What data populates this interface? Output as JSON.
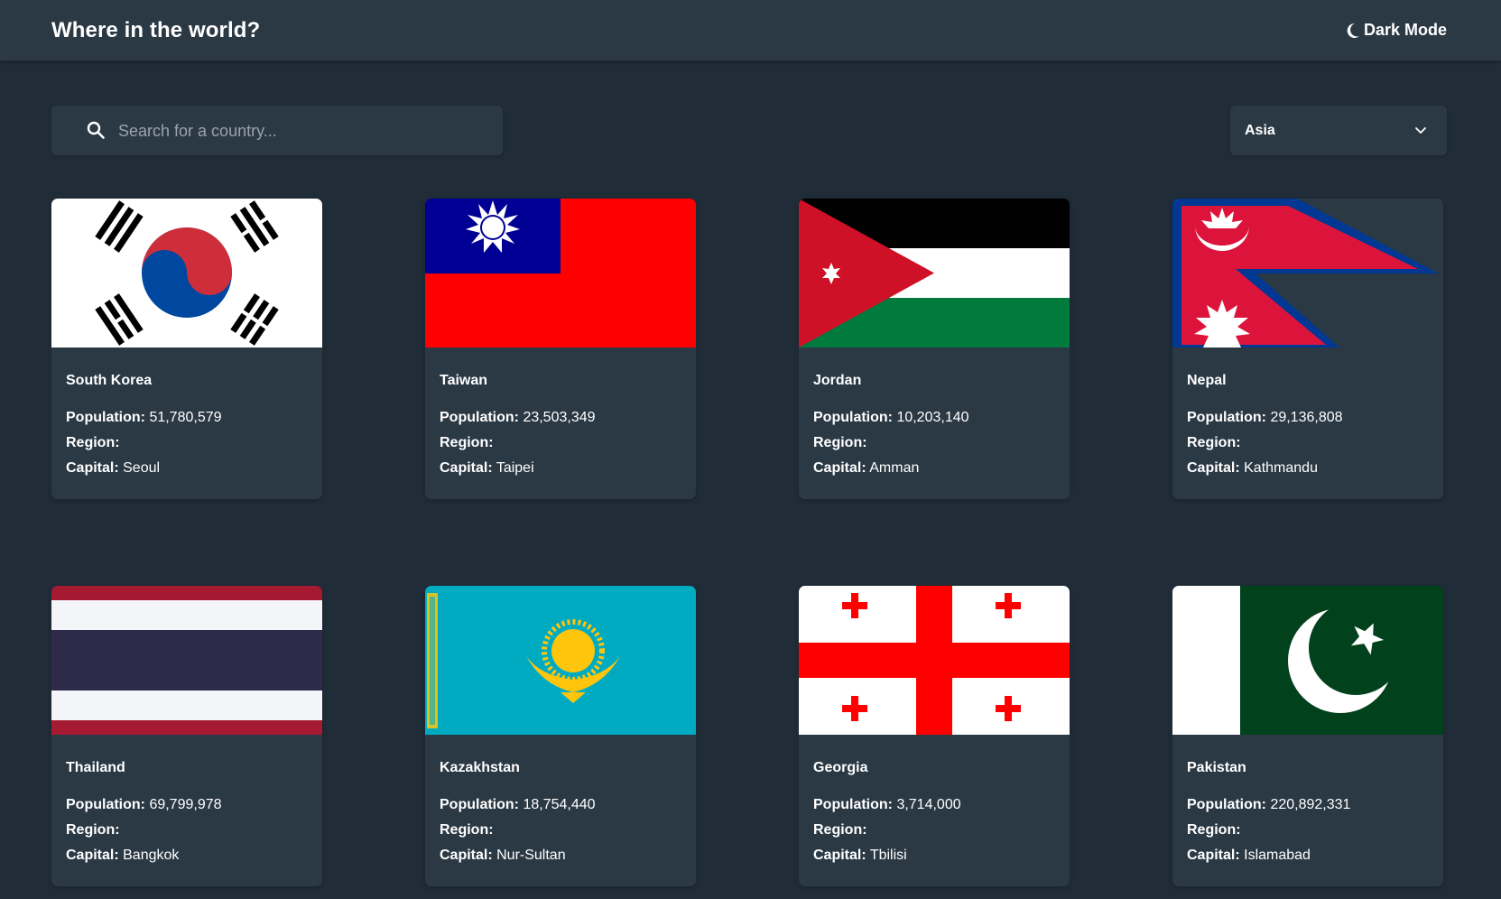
{
  "header": {
    "title": "Where in the world?",
    "mode_label": "Dark Mode"
  },
  "search": {
    "placeholder": "Search for a country...",
    "value": ""
  },
  "filter": {
    "selected": "Asia"
  },
  "labels": {
    "population": "Population:",
    "region": "Region:",
    "capital": "Capital:"
  },
  "countries": [
    {
      "name": "South Korea",
      "population": "51,780,579",
      "region": "",
      "capital": "Seoul",
      "flag": "south-korea-flag"
    },
    {
      "name": "Taiwan",
      "population": "23,503,349",
      "region": "",
      "capital": "Taipei",
      "flag": "taiwan-flag"
    },
    {
      "name": "Jordan",
      "population": "10,203,140",
      "region": "",
      "capital": "Amman",
      "flag": "jordan-flag"
    },
    {
      "name": "Nepal",
      "population": "29,136,808",
      "region": "",
      "capital": "Kathmandu",
      "flag": "nepal-flag"
    },
    {
      "name": "Thailand",
      "population": "69,799,978",
      "region": "",
      "capital": "Bangkok",
      "flag": "thailand-flag"
    },
    {
      "name": "Kazakhstan",
      "population": "18,754,440",
      "region": "",
      "capital": "Nur-Sultan",
      "flag": "kazakhstan-flag"
    },
    {
      "name": "Georgia",
      "population": "3,714,000",
      "region": "",
      "capital": "Tbilisi",
      "flag": "georgia-flag"
    },
    {
      "name": "Pakistan",
      "population": "220,892,331",
      "region": "",
      "capital": "Islamabad",
      "flag": "pakistan-flag"
    }
  ],
  "colors": {
    "background": "#202c37",
    "element": "#2b3945",
    "text": "#ffffff"
  }
}
